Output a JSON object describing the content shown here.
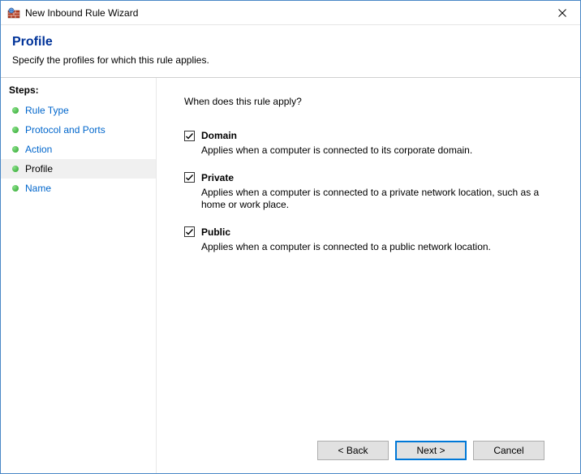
{
  "window": {
    "title": "New Inbound Rule Wizard"
  },
  "header": {
    "title": "Profile",
    "description": "Specify the profiles for which this rule applies."
  },
  "steps": {
    "heading": "Steps:",
    "items": [
      {
        "label": "Rule Type",
        "current": false
      },
      {
        "label": "Protocol and Ports",
        "current": false
      },
      {
        "label": "Action",
        "current": false
      },
      {
        "label": "Profile",
        "current": true
      },
      {
        "label": "Name",
        "current": false
      }
    ]
  },
  "content": {
    "prompt": "When does this rule apply?",
    "options": [
      {
        "label": "Domain",
        "checked": true,
        "description": "Applies when a computer is connected to its corporate domain."
      },
      {
        "label": "Private",
        "checked": true,
        "description": "Applies when a computer is connected to a private network location, such as a home or work place."
      },
      {
        "label": "Public",
        "checked": true,
        "description": "Applies when a computer is connected to a public network location."
      }
    ]
  },
  "buttons": {
    "back": "< Back",
    "next": "Next >",
    "cancel": "Cancel"
  }
}
